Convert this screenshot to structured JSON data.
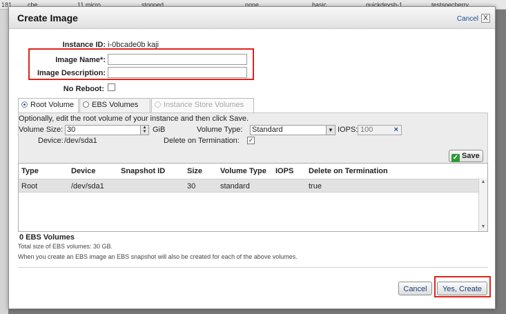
{
  "background": {
    "strip_texts": [
      "181",
      "cbe",
      "11 micro",
      "stopped",
      "none",
      "basic",
      "quickdevsb-1",
      "testspecherry"
    ]
  },
  "dialog": {
    "title": "Create Image",
    "cancel_link": "Cancel",
    "close_glyph": "X"
  },
  "form": {
    "instance_id_label": "Instance ID:",
    "instance_id_value": "i-0bcade0b kaji",
    "image_name_label": "Image Name*:",
    "image_name_value": "",
    "image_description_label": "Image Description:",
    "image_description_value": "",
    "no_reboot_label": "No Reboot:",
    "no_reboot_checked": false
  },
  "tabs": [
    {
      "label": "Root Volume",
      "selected": true,
      "disabled": false
    },
    {
      "label": "EBS Volumes",
      "selected": false,
      "disabled": false
    },
    {
      "label": "Instance Store Volumes",
      "selected": false,
      "disabled": true
    }
  ],
  "root_volume": {
    "instructions": "Optionally, edit the root volume of your instance and then click Save.",
    "volume_size_label": "Volume Size:",
    "volume_size_value": "30",
    "volume_size_unit": "GiB",
    "volume_type_label": "Volume Type:",
    "volume_type_value": "Standard",
    "iops_label": "IOPS:",
    "iops_value": "100",
    "iops_clear_glyph": "×",
    "device_label": "Device:",
    "device_value": "/dev/sda1",
    "delete_on_termination_label": "Delete on Termination:",
    "delete_on_termination_checked": true,
    "save_label": "Save"
  },
  "volume_table": {
    "columns": [
      "Type",
      "Device",
      "Snapshot ID",
      "Size",
      "Volume Type",
      "IOPS",
      "Delete on Termination"
    ],
    "rows": [
      {
        "type": "Root",
        "device": "/dev/sda1",
        "snapshot_id": "",
        "size": "30",
        "volume_type": "standard",
        "iops": "",
        "delete_on_termination": "true"
      }
    ]
  },
  "summary": {
    "title": "0 EBS Volumes",
    "total_size_text": "Total size of EBS volumes: 30 GB.",
    "note": "When you create an EBS image an EBS snapshot will also be created for each of the above volumes."
  },
  "footer": {
    "cancel_label": "Cancel",
    "create_label": "Yes, Create"
  },
  "colors": {
    "highlight_red": "#e0211b",
    "save_icon_green": "#2f9a38",
    "link_blue": "#1a4f9c"
  }
}
